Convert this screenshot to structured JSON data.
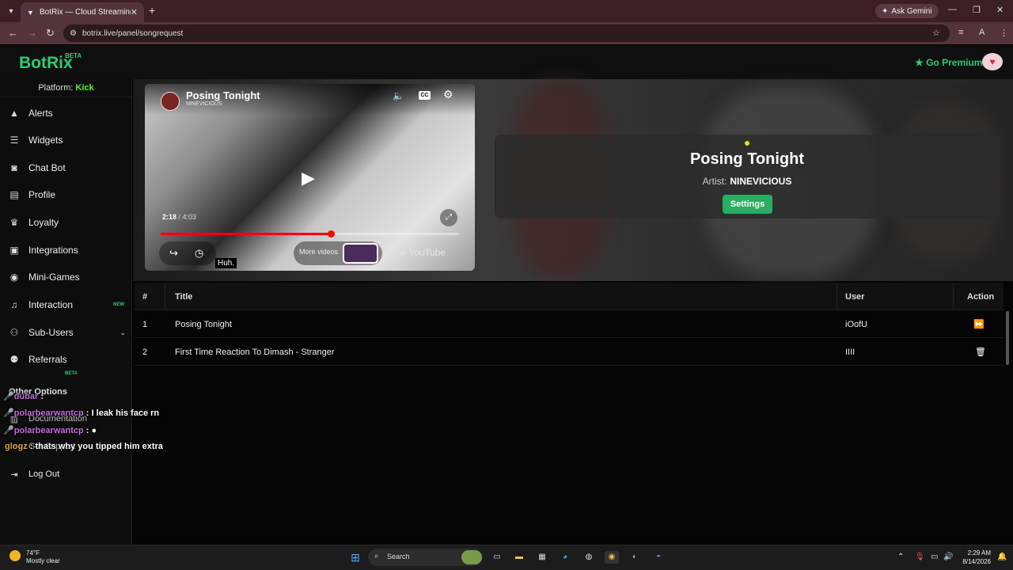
{
  "browser": {
    "tab_title": "BotRix — Cloud Streaming Bot",
    "new_tab_glyph": "+",
    "ask_gemini": "Ask Gemini",
    "url": "botrix.live/panel/songrequest",
    "profile_initial": "A"
  },
  "app": {
    "logo": "BotRix",
    "logo_badge": "BETA",
    "go_premium": "Go Premium"
  },
  "sidebar": {
    "platform_label": "Platform:",
    "platform_value": "Kick",
    "items": [
      {
        "label": "Alerts",
        "icon": "warning-icon"
      },
      {
        "label": "Widgets",
        "icon": "list-icon"
      },
      {
        "label": "Chat Bot",
        "icon": "robot-icon"
      },
      {
        "label": "Profile",
        "icon": "id-card-icon"
      },
      {
        "label": "Loyalty",
        "icon": "trophy-icon"
      },
      {
        "label": "Integrations",
        "icon": "integration-icon"
      },
      {
        "label": "Mini-Games",
        "icon": "gamepad-icon"
      },
      {
        "label": "Interaction",
        "icon": "music-icon",
        "badge": "NEW"
      },
      {
        "label": "Sub-Users",
        "icon": "users-icon",
        "badge": "BETA"
      },
      {
        "label": "Referrals",
        "icon": "referrals-icon"
      }
    ],
    "other_options": "Other Options",
    "sub_items": [
      {
        "label": "Documentation",
        "icon": "book-icon"
      },
      {
        "label": "Get Support",
        "icon": "support-icon"
      },
      {
        "label": "Log Out",
        "icon": "logout-icon"
      }
    ]
  },
  "player": {
    "title": "Posing Tonight",
    "channel": "NINEVICIOUS",
    "current_time": "2:18",
    "duration": "4:03",
    "progress": 0.57,
    "more_videos": "More videos",
    "youtube": "YouTube",
    "tooltip": "Huh."
  },
  "now_playing": {
    "title": "Posing Tonight",
    "artist_label": "Artist:",
    "artist": "NINEVICIOUS",
    "settings_label": "Settings"
  },
  "queue": {
    "headers": [
      "#",
      "Title",
      "User",
      "Action"
    ],
    "rows": [
      {
        "num": "1",
        "title": "Posing Tonight",
        "user": "iOofU",
        "action": "skip-icon"
      },
      {
        "num": "2",
        "title": "First Time Reaction To Dimash - Stranger",
        "user": "IIII",
        "action": "trash-icon"
      }
    ]
  },
  "chat_overlay": [
    {
      "user": "dubar",
      "sep": ":",
      "msg": ""
    },
    {
      "user": "polarbearwantcp",
      "sep": ":",
      "msg": "I leak his face rn"
    },
    {
      "user": "polarbearwantcp",
      "sep": ":",
      "msg": ""
    },
    {
      "user": "glogz",
      "sep": ":",
      "msg": "thats why you tipped him extra"
    }
  ],
  "taskbar": {
    "temp": "74°F",
    "weather": "Mostly clear",
    "search": "Search",
    "time": "2:29 AM",
    "date": "8/14/2026"
  },
  "colors": {
    "accent": "#2ecc71",
    "kick": "#53fc18",
    "progress": "#ff0000"
  }
}
